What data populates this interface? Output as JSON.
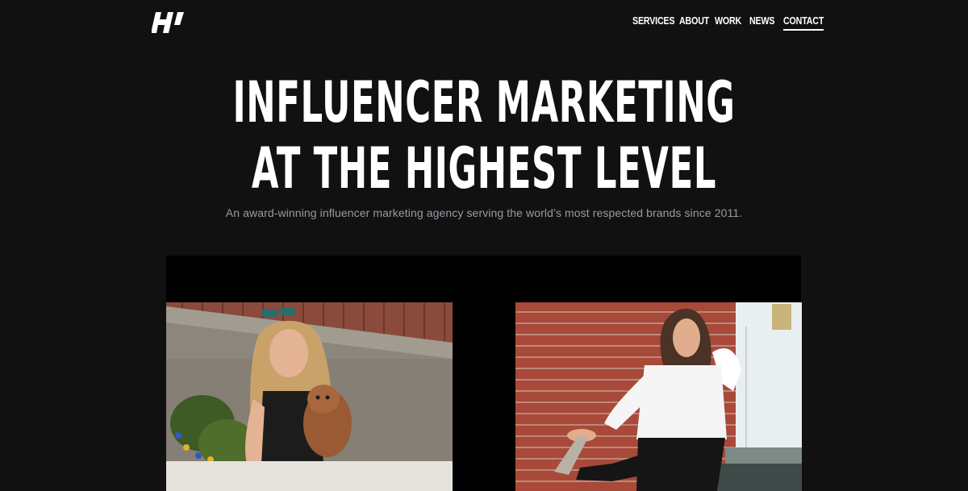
{
  "brand": {
    "logo_text": "H!"
  },
  "nav": {
    "items": [
      {
        "label": "SERVICES",
        "active": false
      },
      {
        "label": "ABOUT",
        "active": false
      },
      {
        "label": "WORK",
        "active": false
      },
      {
        "label": "NEWS",
        "active": false
      },
      {
        "label": "CONTACT",
        "active": true
      }
    ]
  },
  "hero": {
    "title_line1": "INFLUENCER MARKETING",
    "title_line2": "AT THE HIGHEST LEVEL",
    "subtitle": "An award-winning influencer marketing agency serving the world’s most respected brands since 2011."
  },
  "colors": {
    "background": "#111111",
    "text": "#ffffff",
    "subtext": "#9a9aa6",
    "panel": "#000000"
  }
}
